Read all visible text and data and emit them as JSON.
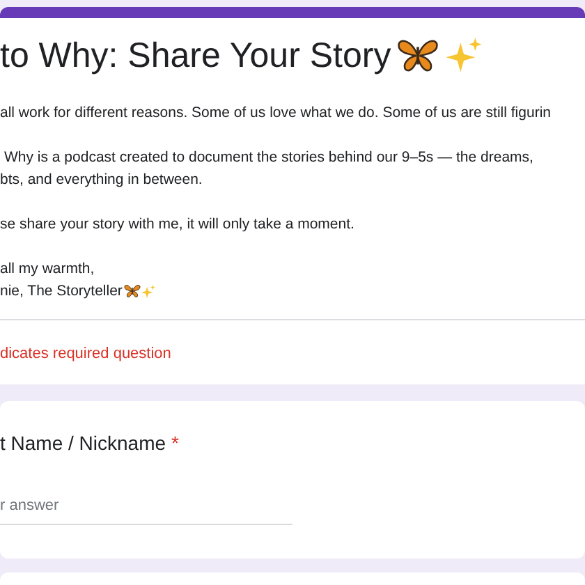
{
  "header": {
    "title": "to Why: Share Your Story",
    "paragraphs": [
      [
        "all work for different reasons. Some of us love what we do. Some of us are still figurin"
      ],
      [
        "Why is a podcast created to document the stories behind our 9–5s — the dreams,",
        "bts, and everything in between."
      ],
      [
        "se share your story with me, it will only take a moment."
      ],
      [
        "all my warmth,",
        "nie, The Storyteller"
      ]
    ],
    "required_note": "dicates required question"
  },
  "questions": [
    {
      "label": "t Name / Nickname",
      "required_mark": "*",
      "placeholder": "r answer"
    }
  ]
}
